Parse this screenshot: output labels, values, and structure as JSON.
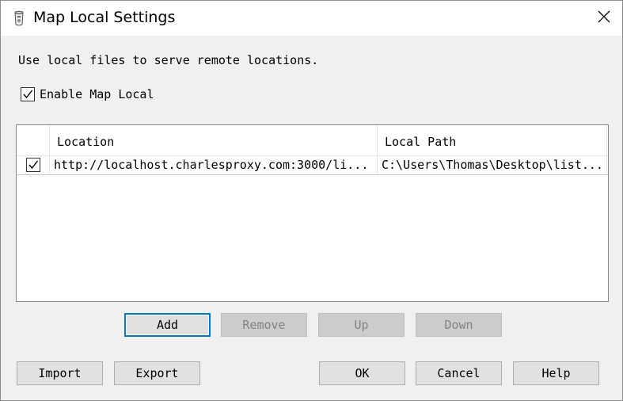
{
  "window": {
    "title": "Map Local Settings"
  },
  "description": "Use local files to serve remote locations.",
  "enable_map_local": {
    "label": "Enable Map Local",
    "checked": true
  },
  "table": {
    "columns": {
      "location": "Location",
      "local_path": "Local Path"
    },
    "rows": [
      {
        "enabled": true,
        "location": "http://localhost.charlesproxy.com:3000/li...",
        "local_path": "C:\\Users\\Thomas\\Desktop\\list..."
      }
    ]
  },
  "row_buttons": {
    "add": "Add",
    "remove": "Remove",
    "up": "Up",
    "down": "Down"
  },
  "footer_buttons": {
    "import": "Import",
    "export": "Export",
    "ok": "OK",
    "cancel": "Cancel",
    "help": "Help"
  },
  "colors": {
    "dialog_bg": "#f0f0f0",
    "focus_border": "#0078d7",
    "disabled_text": "#838383"
  }
}
